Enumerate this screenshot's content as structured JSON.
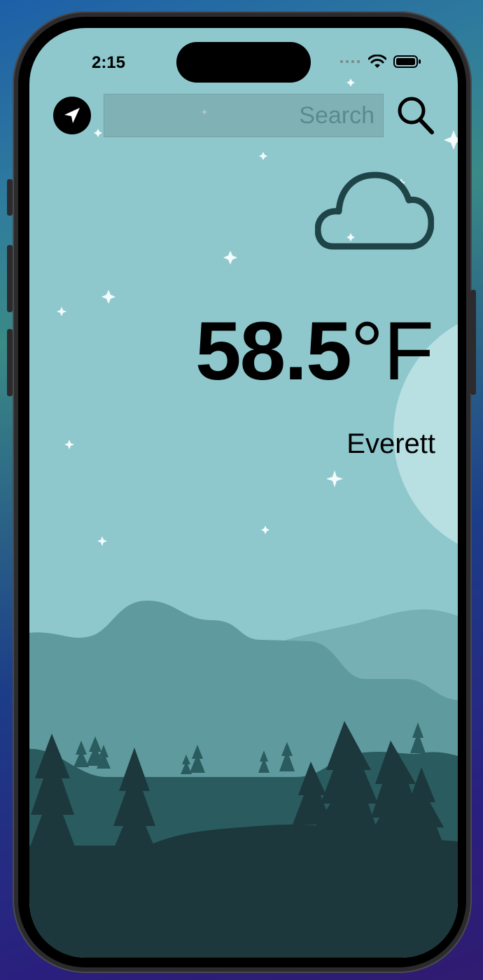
{
  "status_bar": {
    "time": "2:15"
  },
  "toolbar": {
    "location_icon": "location-arrow-icon",
    "search_placeholder": "Search",
    "search_value": "",
    "search_icon": "magnifier-icon"
  },
  "weather": {
    "condition_icon": "cloud-icon",
    "temperature_value": "58.5",
    "temperature_unit": "°F",
    "city": "Everett"
  },
  "colors": {
    "sky": "#8ec8cd",
    "mountain_far": "#5e9a9e",
    "hills": "#2a5b5e",
    "foreground": "#1c383c",
    "cloud_stroke": "#1e4448",
    "moon": "#b8dfe2"
  }
}
